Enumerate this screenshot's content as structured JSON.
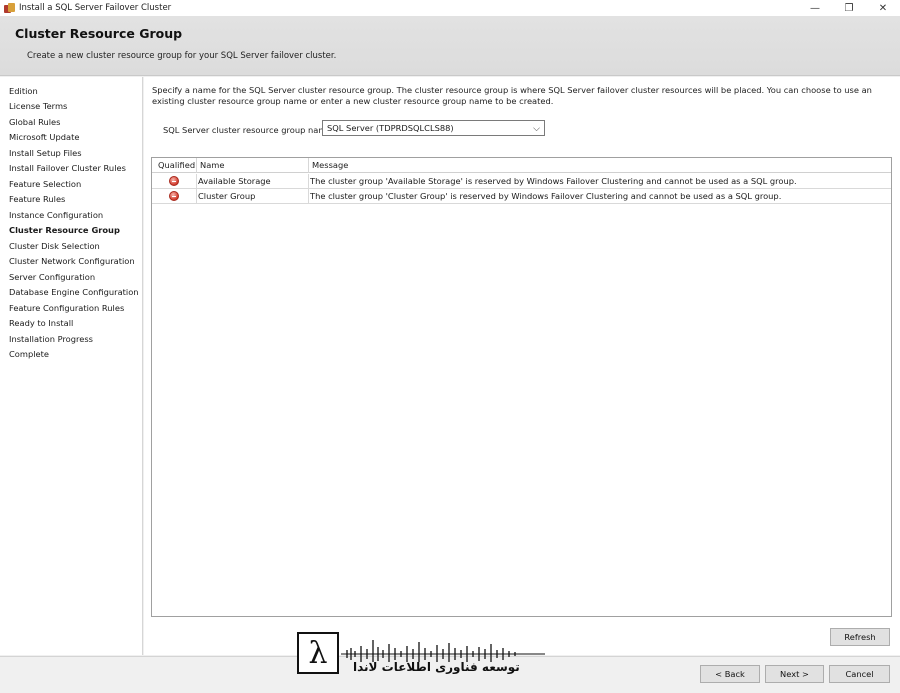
{
  "window": {
    "title": "Install a SQL Server Failover Cluster",
    "controls": {
      "minimize": "—",
      "restore": "❐",
      "close": "✕"
    }
  },
  "header": {
    "title": "Cluster Resource Group",
    "subtitle": "Create a new cluster resource group for your SQL Server failover cluster."
  },
  "sidebar": {
    "items": [
      {
        "label": "Edition",
        "active": false
      },
      {
        "label": "License Terms",
        "active": false
      },
      {
        "label": "Global Rules",
        "active": false
      },
      {
        "label": "Microsoft Update",
        "active": false
      },
      {
        "label": "Install Setup Files",
        "active": false
      },
      {
        "label": "Install Failover Cluster Rules",
        "active": false
      },
      {
        "label": "Feature Selection",
        "active": false
      },
      {
        "label": "Feature Rules",
        "active": false
      },
      {
        "label": "Instance Configuration",
        "active": false
      },
      {
        "label": "Cluster Resource Group",
        "active": true
      },
      {
        "label": "Cluster Disk Selection",
        "active": false
      },
      {
        "label": "Cluster Network Configuration",
        "active": false
      },
      {
        "label": "Server Configuration",
        "active": false
      },
      {
        "label": "Database Engine Configuration",
        "active": false
      },
      {
        "label": "Feature Configuration Rules",
        "active": false
      },
      {
        "label": "Ready to Install",
        "active": false
      },
      {
        "label": "Installation Progress",
        "active": false
      },
      {
        "label": "Complete",
        "active": false
      }
    ]
  },
  "main": {
    "description": "Specify a name for the SQL Server cluster resource group. The cluster resource group is where SQL Server failover cluster resources will be placed. You can choose to use an existing cluster resource group name or enter a new cluster resource group name to be created.",
    "resource_group_label": "SQL Server cluster resource group name:",
    "resource_group_value": "SQL Server (TDPRDSQLCLS88)",
    "grid": {
      "columns": [
        "Qualified",
        "Name",
        "Message"
      ],
      "rows": [
        {
          "qualified_icon": "error-icon",
          "name": "Available Storage",
          "message": "The cluster group 'Available Storage' is reserved by Windows Failover Clustering and cannot be used as a SQL group."
        },
        {
          "qualified_icon": "error-icon",
          "name": "Cluster Group",
          "message": "The cluster group 'Cluster Group' is reserved by Windows Failover Clustering and cannot be used as a SQL group."
        }
      ]
    },
    "refresh_label": "Refresh"
  },
  "footer": {
    "back_label": "< Back",
    "next_label": "Next >",
    "cancel_label": "Cancel"
  },
  "watermark": {
    "logo_glyph": "λ",
    "text": "توسعه فناوری اطلاعات لاندا"
  }
}
